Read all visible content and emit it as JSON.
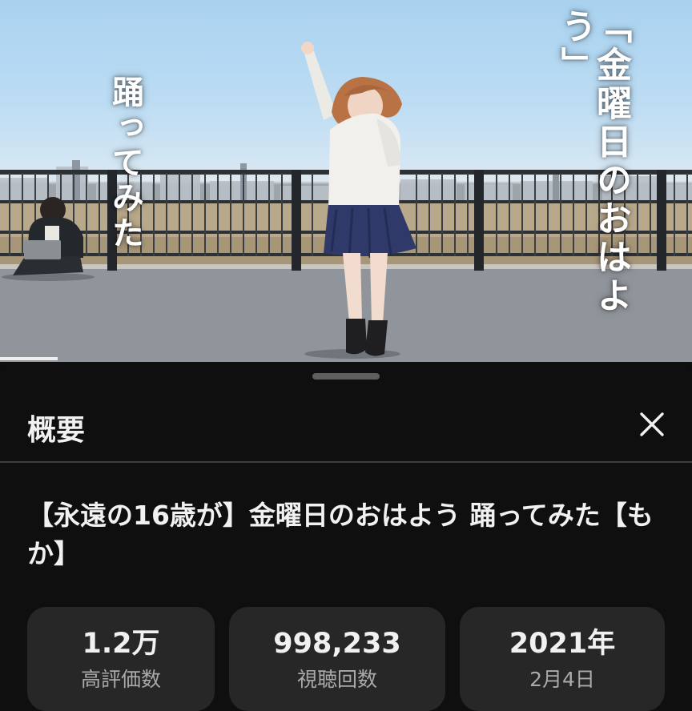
{
  "video": {
    "caption_right": "「金曜日のおはよう」",
    "caption_left": "踊ってみた",
    "progress_fraction": 0.083
  },
  "sheet": {
    "title": "概要",
    "close_icon": "close-icon",
    "video_title": "【永遠の16歳が】金曜日のおはよう 踊ってみた【もか】",
    "stats": {
      "likes": {
        "value": "1.2万",
        "label": "高評価数"
      },
      "views": {
        "value": "998,233",
        "label": "視聴回数"
      },
      "date": {
        "value": "2021年",
        "label": "2月4日"
      }
    }
  },
  "colors": {
    "sheet_background": "#0f0f0f",
    "stat_card": "#272727",
    "primary_text": "#f1f1f1",
    "secondary_text": "#aaaaaa"
  }
}
